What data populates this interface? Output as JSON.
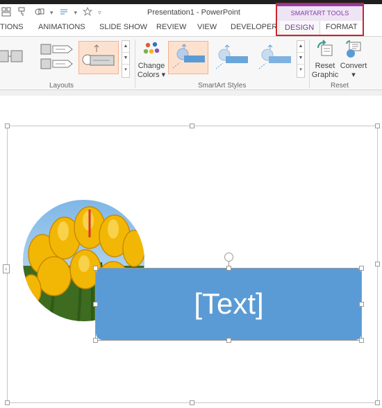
{
  "window": {
    "title": "Presentation1 - PowerPoint"
  },
  "quick_access": {
    "items": [
      "layout-icon",
      "format-painter-icon",
      "shape-icon",
      "more-icon"
    ]
  },
  "contextual": {
    "group_label": "SMARTART TOOLS",
    "tabs": [
      "DESIGN",
      "FORMAT"
    ],
    "highlight_color": "#c9252d",
    "accent_color": "#7d3aa4"
  },
  "tabs": [
    "TIONS",
    "ANIMATIONS",
    "SLIDE SHOW",
    "REVIEW",
    "VIEW",
    "DEVELOPER"
  ],
  "ribbon": {
    "layouts_label": "Layouts",
    "styles_label": "SmartArt Styles",
    "reset_label": "Reset",
    "change_colors_line1": "Change",
    "change_colors_line2": "Colors",
    "reset_graphic_line1": "Reset",
    "reset_graphic_line2": "Graphic",
    "convert_label": "Convert"
  },
  "slide": {
    "placeholder_text": "[Text]",
    "shape_color": "#5b9bd5",
    "picture": "yellow-tulips-photo"
  }
}
